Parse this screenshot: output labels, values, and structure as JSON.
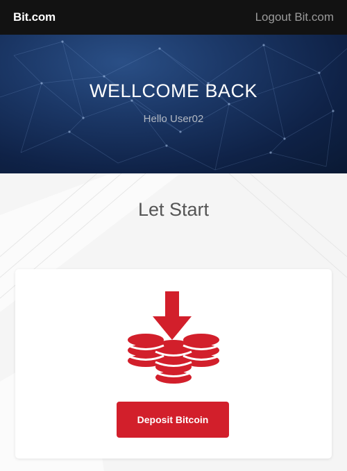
{
  "navbar": {
    "brand": "Bit.com",
    "logout_label": "Logout Bit.com"
  },
  "hero": {
    "title": "WELLCOME BACK",
    "greeting": "Hello User02"
  },
  "main": {
    "section_title": "Let Start",
    "deposit_card": {
      "icon": "deposit-coins-icon",
      "button_label": "Deposit Bitcoin"
    }
  },
  "colors": {
    "navbar_bg": "#121212",
    "hero_bg": "#1b3766",
    "accent_red": "#d21f2b"
  }
}
